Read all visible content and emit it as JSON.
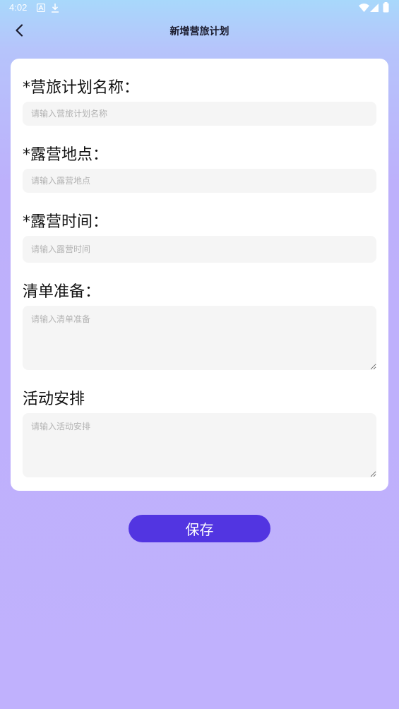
{
  "status_bar": {
    "time": "4:02",
    "icons": [
      "a-notification-icon",
      "download-icon",
      "wifi-icon",
      "signal-icon",
      "battery-icon"
    ]
  },
  "header": {
    "title": "新增营旅计划",
    "back_icon": "chevron-left-icon"
  },
  "form": {
    "plan_name": {
      "label": "*营旅计划名称：",
      "placeholder": "请输入营旅计划名称",
      "value": ""
    },
    "location": {
      "label": "*露营地点：",
      "placeholder": "请输入露营地点",
      "value": ""
    },
    "time": {
      "label": "*露营时间：",
      "placeholder": "请输入露营时间",
      "value": ""
    },
    "checklist": {
      "label": "清单准备：",
      "placeholder": "请输入清单准备",
      "value": ""
    },
    "activities": {
      "label": "活动安排",
      "placeholder": "请输入活动安排",
      "value": ""
    }
  },
  "actions": {
    "save_label": "保存"
  },
  "colors": {
    "accent": "#5235e1",
    "background_bottom": "#c0b1fd",
    "background_top": "#a8d8fb",
    "card": "#ffffff",
    "input_bg": "#f5f5f5"
  }
}
